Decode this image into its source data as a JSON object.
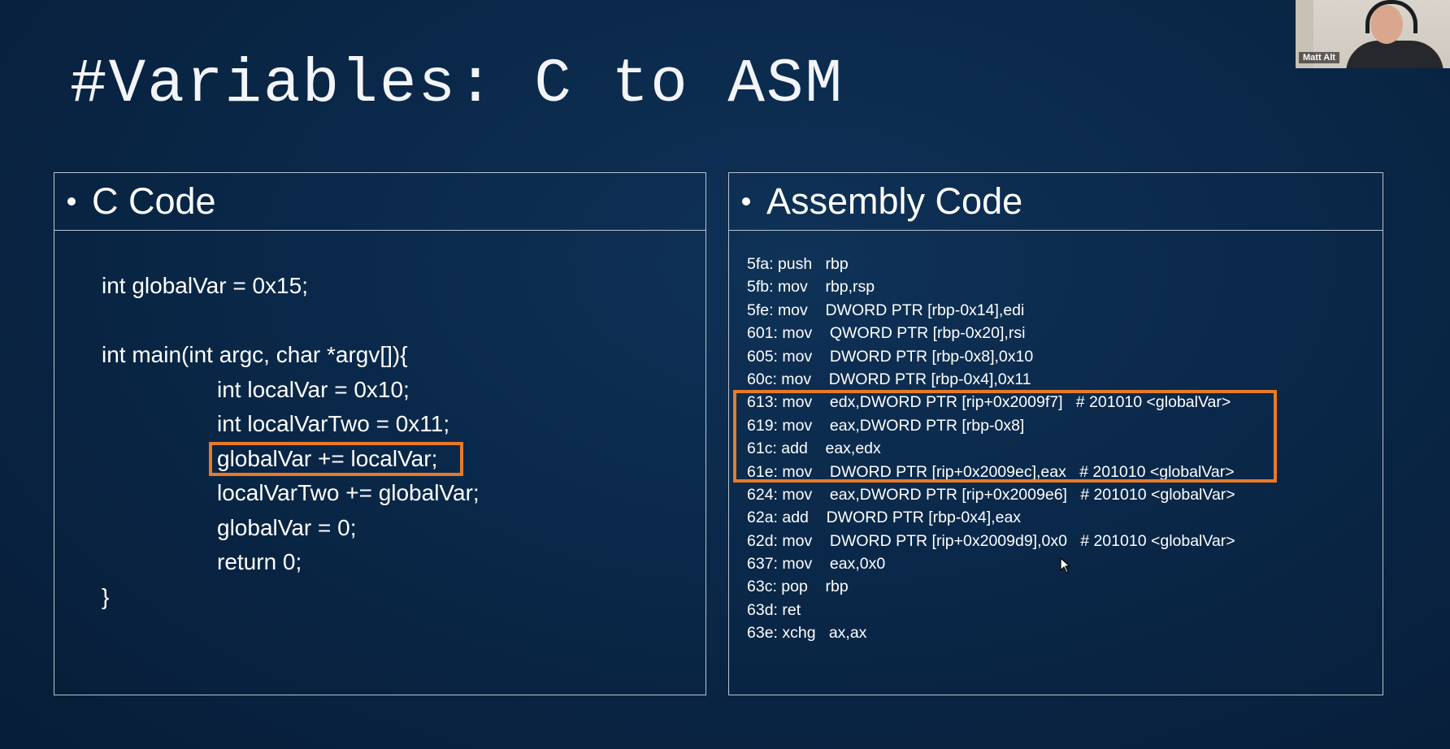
{
  "slide": {
    "title": "#Variables: C to ASM"
  },
  "c_panel": {
    "header": "C Code",
    "lines": [
      "int globalVar = 0x15;",
      "",
      "int main(int argc, char *argv[]){",
      "int localVar = 0x10;",
      "int localVarTwo = 0x11;",
      "globalVar += localVar;",
      "localVarTwo += globalVar;",
      "globalVar = 0;",
      "return 0;",
      "}"
    ]
  },
  "asm_panel": {
    "header": "Assembly Code",
    "lines": [
      "5fa: push   rbp",
      "5fb: mov    rbp,rsp",
      "5fe: mov    DWORD PTR [rbp-0x14],edi",
      "601: mov    QWORD PTR [rbp-0x20],rsi",
      "605: mov    DWORD PTR [rbp-0x8],0x10",
      "60c: mov    DWORD PTR [rbp-0x4],0x11",
      "613: mov    edx,DWORD PTR [rip+0x2009f7]   # 201010 <globalVar>",
      "619: mov    eax,DWORD PTR [rbp-0x8]",
      "61c: add    eax,edx",
      "61e: mov    DWORD PTR [rip+0x2009ec],eax   # 201010 <globalVar>",
      "624: mov    eax,DWORD PTR [rip+0x2009e6]   # 201010 <globalVar>",
      "62a: add    DWORD PTR [rbp-0x4],eax",
      "62d: mov    DWORD PTR [rip+0x2009d9],0x0   # 201010 <globalVar>",
      "637: mov    eax,0x0",
      "63c: pop    rbp",
      "63d: ret",
      "63e: xchg   ax,ax"
    ]
  },
  "webcam": {
    "name": "Matt Alt"
  },
  "colors": {
    "background": "#0a2849",
    "highlight": "#e87a27",
    "border": "#b9c3cf"
  }
}
